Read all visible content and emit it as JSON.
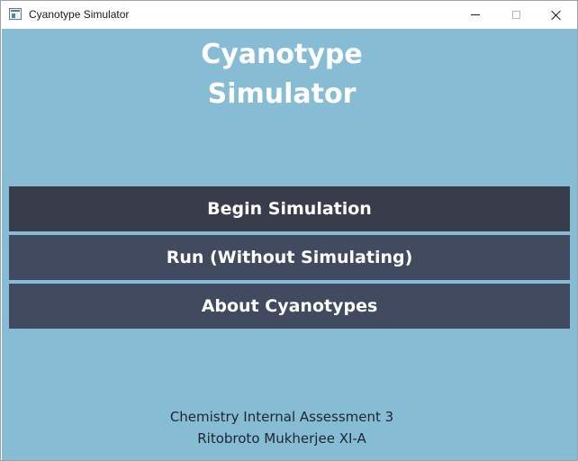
{
  "window": {
    "title": "Cyanotype Simulator",
    "icon": "app-window-icon",
    "controls": {
      "minimize": "minimize-icon",
      "maximize": "maximize-icon",
      "close": "close-icon"
    }
  },
  "main": {
    "title_line1": "Cyanotype",
    "title_line2": "Simulator",
    "buttons": {
      "begin": "Begin Simulation",
      "run": "Run (Without Simulating)",
      "about": "About Cyanotypes"
    },
    "credits": {
      "line1": "Chemistry Internal Assessment 3",
      "line2": "Ritobroto Mukherjee XI-A"
    }
  },
  "colors": {
    "background": "#87bcd5",
    "button_active": "#383c4b",
    "button": "#414a5e",
    "title_text": "#ffffff",
    "credit_text": "#1e2530"
  }
}
